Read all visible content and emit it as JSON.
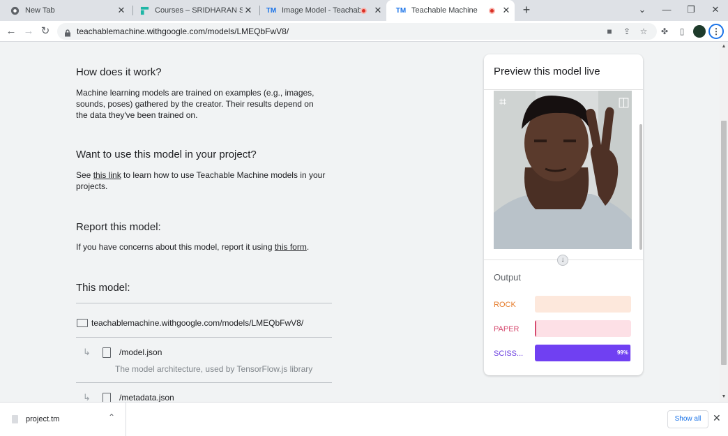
{
  "tabs": [
    {
      "title": "New Tab",
      "active": false,
      "favicon": "chrome-icon",
      "recording": false
    },
    {
      "title": "Courses – SRIDHARAN S – Learn",
      "active": false,
      "favicon": "courses-icon",
      "recording": false
    },
    {
      "title": "Image Model - Teachable Ma",
      "active": false,
      "favicon": "tm-icon",
      "recording": true
    },
    {
      "title": "Teachable Machine",
      "active": true,
      "favicon": "tm-icon",
      "recording": true
    }
  ],
  "favicon_text": "TM",
  "address_bar": {
    "url": "teachablemachine.withgoogle.com/models/LMEQbFwV8/"
  },
  "content": {
    "how_heading": "How does it work?",
    "how_text": "Machine learning models are trained on examples (e.g., images, sounds, poses) gathered by the creator. Their results depend on the data they've been trained on.",
    "use_heading": "Want to use this model in your project?",
    "use_text_before": "See ",
    "use_link": "this link",
    "use_text_after": " to learn how to use Teachable Machine models in your projects.",
    "report_heading": "Report this model:",
    "report_text_before": "If you have concerns about this model, report it using ",
    "report_link": "this form",
    "report_text_after": ".",
    "model_heading": "This model:",
    "model_url": "teachablemachine.withgoogle.com/models/LMEQbFwV8/",
    "files": [
      {
        "name": "/model.json",
        "description": "The model architecture, used by TensorFlow.js library"
      },
      {
        "name": "/metadata.json",
        "description": ""
      }
    ]
  },
  "preview": {
    "title": "Preview this model live",
    "output_label": "Output",
    "classes": [
      {
        "label": "ROCK",
        "fraction": 0.0,
        "label_color": "#e67c2b",
        "track_color": "#fde8dc",
        "fill_color": "#fbd3bd",
        "pct": ""
      },
      {
        "label": "PAPER",
        "fraction": 0.01,
        "label_color": "#d64a6f",
        "track_color": "#fde0e6",
        "fill_color": "#d64a6f",
        "pct": ""
      },
      {
        "label": "SCISS...",
        "fraction": 0.99,
        "label_color": "#6b3fe0",
        "track_color": "#e7defb",
        "fill_color": "#7040f2",
        "pct": "99%"
      }
    ]
  },
  "download_shelf": {
    "file_name": "project.tm",
    "show_all": "Show all"
  }
}
